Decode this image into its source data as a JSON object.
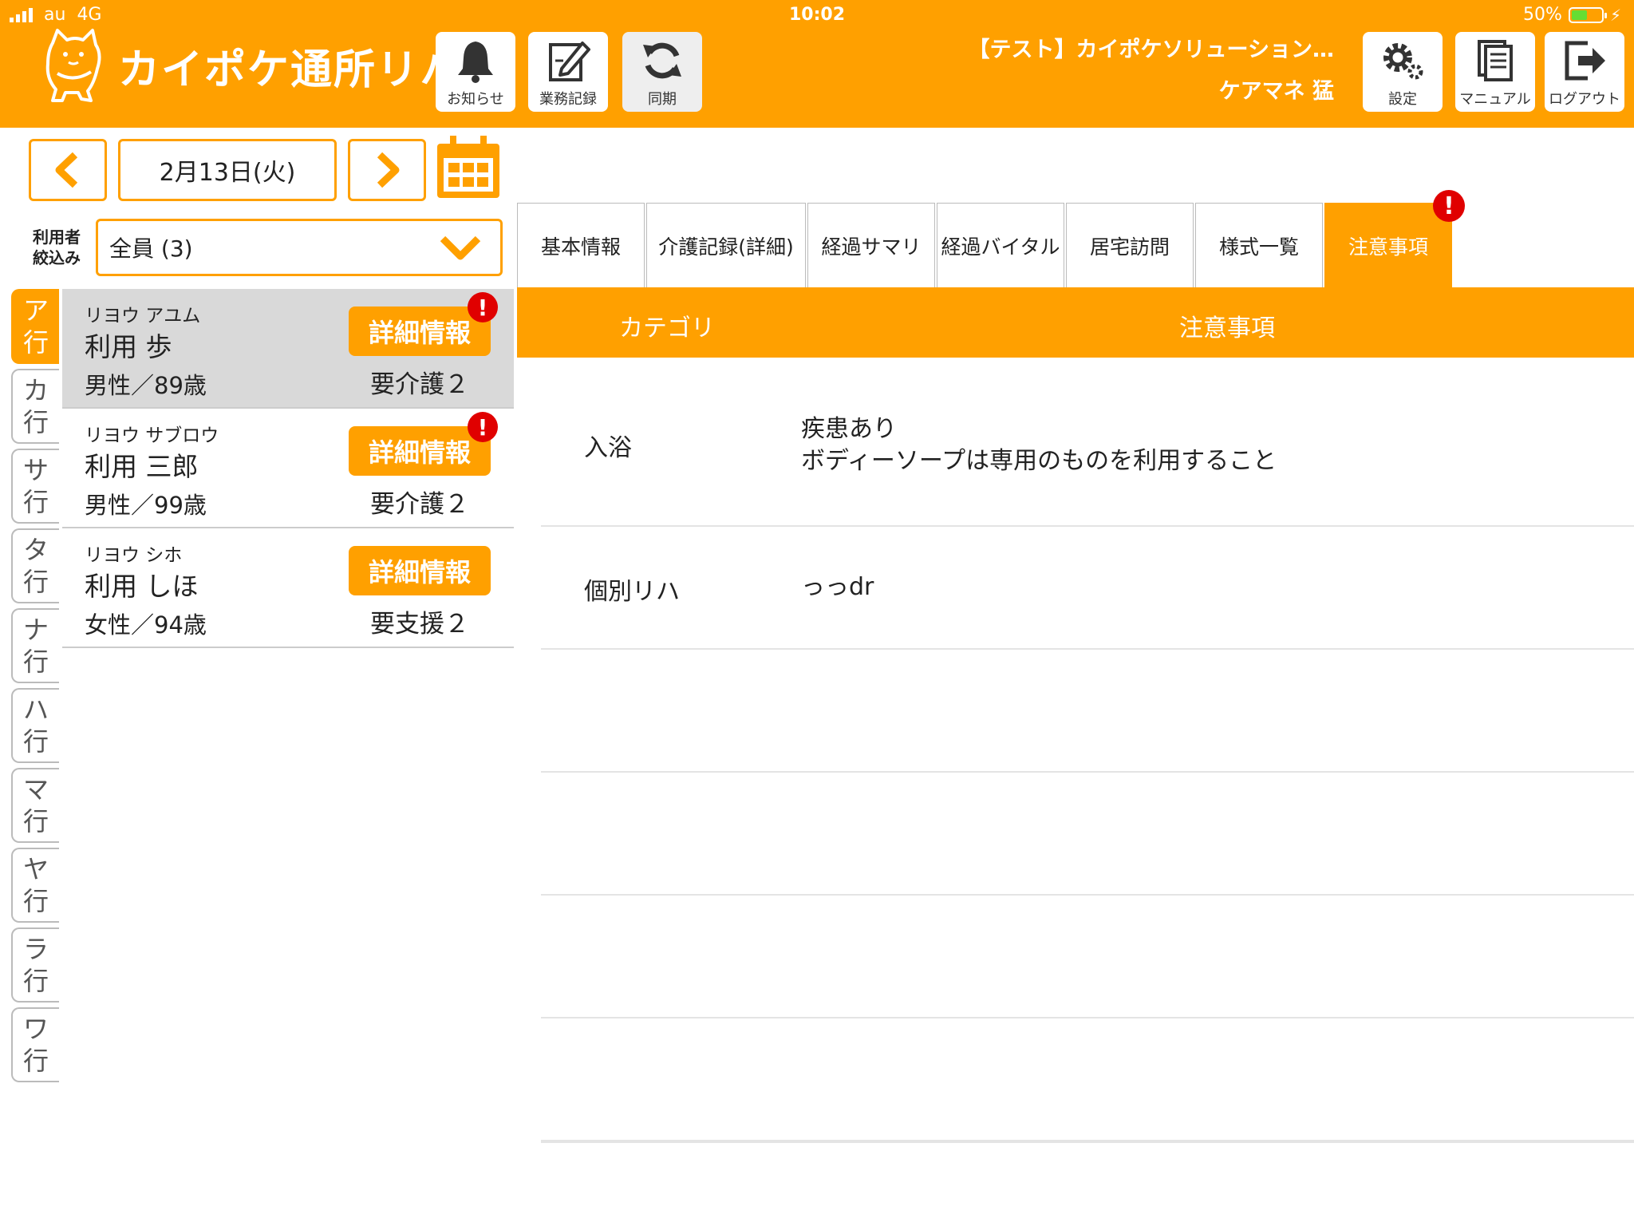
{
  "status": {
    "carrier": "au",
    "network": "4G",
    "time": "10:02",
    "battery": "50%",
    "battery_level": 0.5
  },
  "app": {
    "title": "カイポケ通所リハ"
  },
  "header_buttons": {
    "notice": "お知らせ",
    "records": "業務記録",
    "sync": "同期",
    "settings": "設定",
    "manual": "マニュアル",
    "logout": "ログアウト"
  },
  "account": {
    "facility": "【テスト】カイポケソリューション…",
    "staff": "ケアマネ 猛"
  },
  "date_nav": {
    "date": "2月13日(火)"
  },
  "filter": {
    "label_line1": "利用者",
    "label_line2": "絞込み",
    "value": "全員 (3)"
  },
  "kana_index": [
    {
      "top": "ア",
      "bottom": "行"
    },
    {
      "top": "カ",
      "bottom": "行"
    },
    {
      "top": "サ",
      "bottom": "行"
    },
    {
      "top": "タ",
      "bottom": "行"
    },
    {
      "top": "ナ",
      "bottom": "行"
    },
    {
      "top": "ハ",
      "bottom": "行"
    },
    {
      "top": "マ",
      "bottom": "行"
    },
    {
      "top": "ヤ",
      "bottom": "行"
    },
    {
      "top": "ラ",
      "bottom": "行"
    },
    {
      "top": "ワ",
      "bottom": "行"
    }
  ],
  "users": [
    {
      "kana": "リヨウ アユム",
      "name": "利用 歩",
      "sex_age": "男性／89歳",
      "detail": "詳細情報",
      "care": "要介護２",
      "alert": "!"
    },
    {
      "kana": "リヨウ サブロウ",
      "name": "利用 三郎",
      "sex_age": "男性／99歳",
      "detail": "詳細情報",
      "care": "要介護２",
      "alert": "!"
    },
    {
      "kana": "リヨウ シホ",
      "name": "利用 しほ",
      "sex_age": "女性／94歳",
      "detail": "詳細情報",
      "care": "要支援２"
    }
  ],
  "tabs": [
    "基本情報",
    "介護記録(詳細)",
    "経過サマリ",
    "経過バイタル",
    "居宅訪問",
    "様式一覧",
    "注意事項"
  ],
  "tab_alert": "!",
  "table": {
    "header_category": "カテゴリ",
    "header_notes": "注意事項",
    "rows": [
      {
        "category": "入浴",
        "note_line1": "疾患あり",
        "note_line2": "ボディーソープは専用のものを利用すること"
      },
      {
        "category": "個別リハ",
        "note_line1": "っっdr",
        "note_line2": ""
      }
    ]
  },
  "colors": {
    "accent": "#FFA000",
    "alert": "#E00000",
    "selected_row": "#D9D9D9"
  }
}
